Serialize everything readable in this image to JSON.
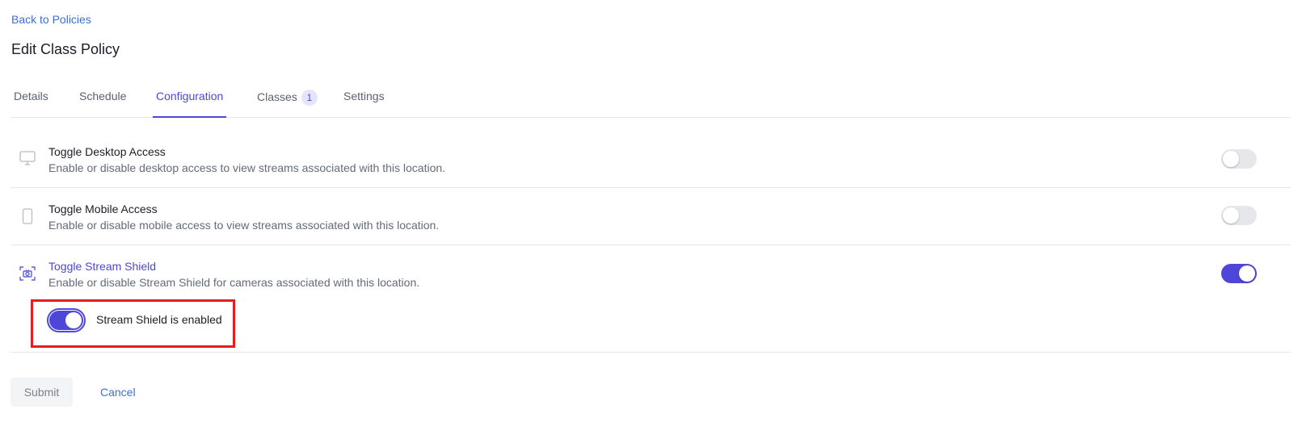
{
  "nav": {
    "back_label": "Back to Policies"
  },
  "page": {
    "title": "Edit Class Policy"
  },
  "tabs": [
    {
      "label": "Details",
      "active": false
    },
    {
      "label": "Schedule",
      "active": false
    },
    {
      "label": "Configuration",
      "active": true
    },
    {
      "label": "Classes",
      "active": false,
      "badge": "1"
    },
    {
      "label": "Settings",
      "active": false
    }
  ],
  "settings": [
    {
      "icon": "monitor-icon",
      "title": "Toggle Desktop Access",
      "description": "Enable or disable desktop access to view streams associated with this location.",
      "enabled": false
    },
    {
      "icon": "mobile-icon",
      "title": "Toggle Mobile Access",
      "description": "Enable or disable mobile access to view streams associated with this location.",
      "enabled": false
    },
    {
      "icon": "camera-shield-icon",
      "title": "Toggle Stream Shield",
      "description": "Enable or disable Stream Shield for cameras associated with this location.",
      "enabled": true
    }
  ],
  "stream_shield": {
    "status_label": "Stream Shield is enabled",
    "enabled": true
  },
  "actions": {
    "submit_label": "Submit",
    "cancel_label": "Cancel"
  },
  "colors": {
    "accent": "#4d46d8",
    "link": "#3b6fd6",
    "highlight": "#e02020",
    "switch_off": "#e6e7eb"
  }
}
